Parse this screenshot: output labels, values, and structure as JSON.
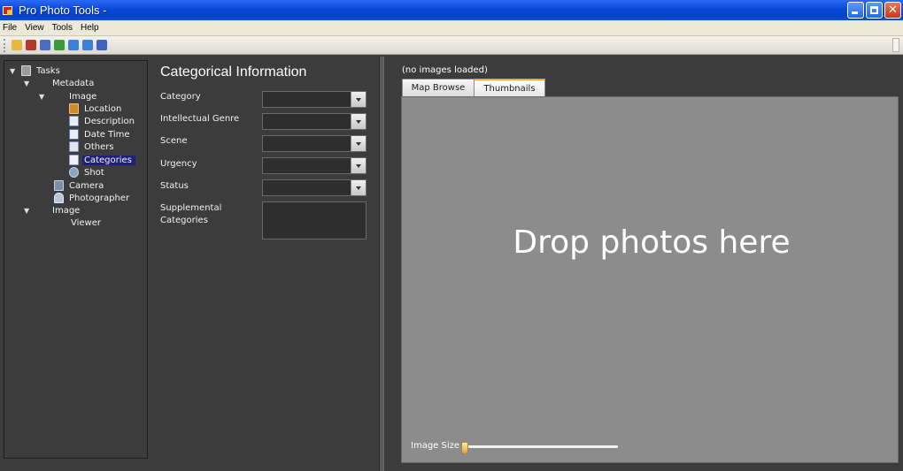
{
  "window": {
    "title": "Pro Photo Tools -"
  },
  "menu": [
    "File",
    "View",
    "Tools",
    "Help"
  ],
  "toolbar": {
    "icons": [
      "open-icon",
      "close-file-icon",
      "edit-icon",
      "upload-icon",
      "undo-icon",
      "redo-icon",
      "help-icon"
    ],
    "colors": [
      "#e7b840",
      "#b33a2a",
      "#4a6cc2",
      "#3a9b3a",
      "#3a7fd8",
      "#3a7fd8",
      "#3f63c0"
    ]
  },
  "tree": {
    "items": [
      {
        "label": "Tasks"
      },
      {
        "label": "Metadata"
      },
      {
        "label": "Image"
      },
      {
        "label": "Location"
      },
      {
        "label": "Description"
      },
      {
        "label": "Date Time"
      },
      {
        "label": "Others"
      },
      {
        "label": "Categories"
      },
      {
        "label": "Shot"
      },
      {
        "label": "Camera"
      },
      {
        "label": "Photographer"
      },
      {
        "label": "Image"
      },
      {
        "label": "Viewer"
      }
    ]
  },
  "form": {
    "title": "Categorical Information",
    "fields": [
      {
        "label": "Category"
      },
      {
        "label": "Intellectual Genre"
      },
      {
        "label": "Scene"
      },
      {
        "label": "Urgency"
      },
      {
        "label": "Status"
      }
    ],
    "supplemental_label_1": "Supplemental",
    "supplemental_label_2": "Categories"
  },
  "content": {
    "status": "(no images loaded)",
    "tabs": [
      "Map Browse",
      "Thumbnails"
    ],
    "active_tab": "Thumbnails",
    "drop_text": "Drop photos here",
    "image_size_label": "Image Size"
  }
}
